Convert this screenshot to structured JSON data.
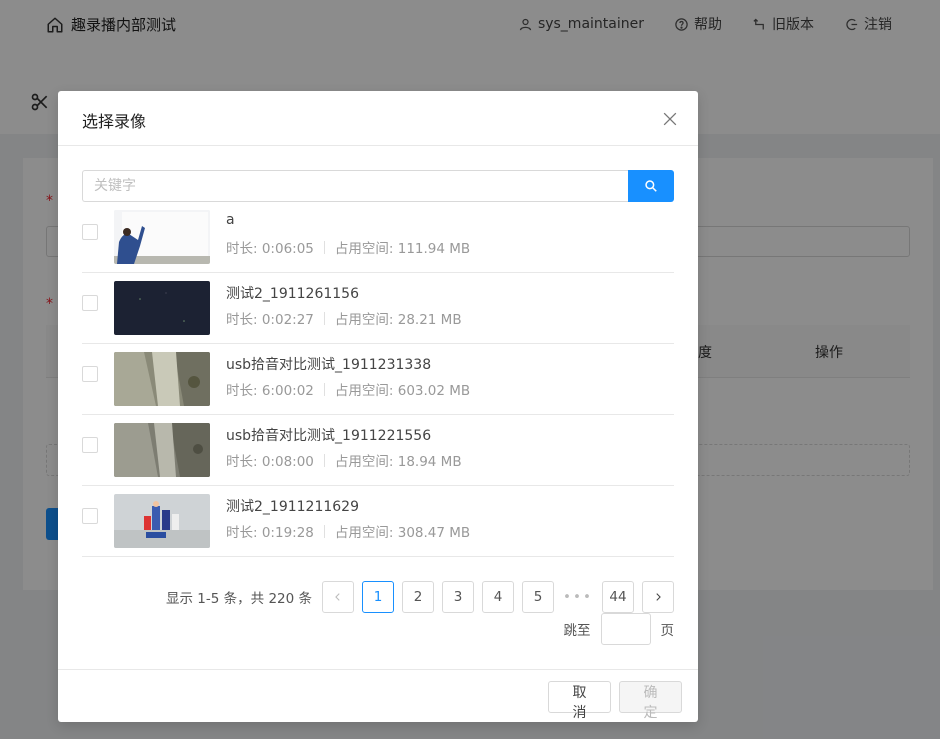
{
  "app": {
    "title": "趣录播内部测试",
    "nav": {
      "user": "sys_maintainer",
      "help": "帮助",
      "old_version": "旧版本",
      "logout": "注销"
    },
    "table_headers": {
      "col_partial": "度",
      "actions": "操作"
    }
  },
  "modal": {
    "title": "选择录像",
    "search": {
      "placeholder": "关键字",
      "value": ""
    },
    "items": [
      {
        "title": "a",
        "duration_label": "时长: 0:06:05",
        "size_label": "占用空间: 111.94 MB",
        "checked": false
      },
      {
        "title": "测试2_1911261156",
        "duration_label": "时长: 0:02:27",
        "size_label": "占用空间: 28.21 MB",
        "checked": false
      },
      {
        "title": "usb拾音对比测试_1911231338",
        "duration_label": "时长: 6:00:02",
        "size_label": "占用空间: 603.02 MB",
        "checked": false
      },
      {
        "title": "usb拾音对比测试_1911221556",
        "duration_label": "时长: 0:08:00",
        "size_label": "占用空间: 18.94 MB",
        "checked": false
      },
      {
        "title": "测试2_1911211629",
        "duration_label": "时长: 0:19:28",
        "size_label": "占用空间: 308.47 MB",
        "checked": false
      }
    ],
    "pagination": {
      "total_text": "显示 1-5 条，共 220 条",
      "pages": [
        "1",
        "2",
        "3",
        "4",
        "5"
      ],
      "current": "1",
      "ellipsis": "•••",
      "last": "44",
      "jump_prefix": "跳至",
      "jump_suffix": "页"
    },
    "footer": {
      "cancel": "取 消",
      "ok": "确 定"
    }
  },
  "colors": {
    "primary": "#1890ff",
    "required": "#f5222d"
  }
}
